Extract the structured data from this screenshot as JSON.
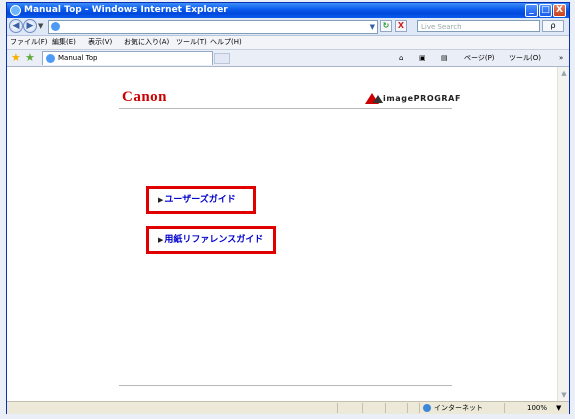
{
  "window": {
    "title": "Manual Top - Windows Internet Explorer",
    "minimize": "_",
    "maximize": "□",
    "close": "X"
  },
  "address_bar": {
    "url": "",
    "refresh_glyph": "↻",
    "stop_glyph": "X",
    "search_placeholder": "Live Search",
    "search_glyph": "ρ"
  },
  "menu": {
    "items": [
      "ファイル(F)",
      "編集(E)",
      "表示(V)",
      "お気に入り(A)",
      "ツール(T)",
      "ヘルプ(H)"
    ]
  },
  "tabs": {
    "active_label": "Manual Top"
  },
  "command_bar": {
    "home": "⌂",
    "feeds": "▣",
    "print": "▤",
    "page": "ページ(P)",
    "tools": "ツール(O)",
    "more": "»"
  },
  "page": {
    "brand_left": "Canon",
    "brand_right": "imagePROGRAF",
    "links": [
      {
        "arrow": "▶",
        "label": "ユーザーズガイド"
      },
      {
        "arrow": "▶",
        "label": "用紙リファレンスガイド"
      }
    ]
  },
  "status_bar": {
    "zone": "インターネット",
    "zoom": "100%"
  },
  "colors": {
    "titlebar": "#0b5ded",
    "link": "#0000cc",
    "highlight_border": "#e00000",
    "canon_red": "#cc0000"
  }
}
